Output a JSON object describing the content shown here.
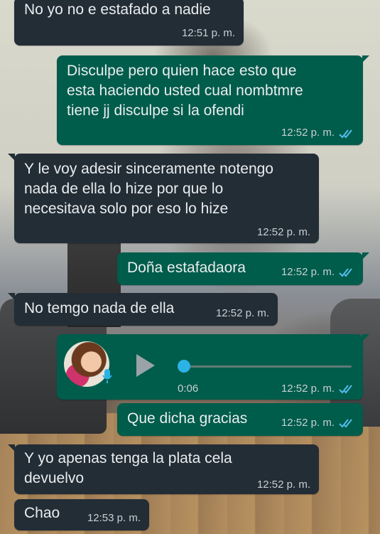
{
  "chat": {
    "messages": [
      {
        "dir": "in",
        "text": "No yo no e estafado a nadie",
        "time": "12:51 p. m."
      },
      {
        "dir": "out",
        "text": "Disculpe pero quien hace esto que\nesta haciendo usted cual nombtmre\ntiene jj disculpe si la ofendi",
        "time": "12:52 p. m.",
        "status": "read"
      },
      {
        "dir": "in",
        "text": "Y le voy adesir sinceramente notengo\nnada de ella lo hize por que lo\nnecesitava solo por eso lo hize",
        "time": "12:52 p. m."
      },
      {
        "dir": "out",
        "text": "Doña estafadaora",
        "time": "12:52 p. m.",
        "status": "read"
      },
      {
        "dir": "in",
        "text": "No temgo nada de ella",
        "time": "12:52 p. m."
      },
      {
        "dir": "out",
        "type": "voice",
        "duration": "0:06",
        "time": "12:52 p. m.",
        "status": "read",
        "progress": 0
      },
      {
        "dir": "out",
        "text": "Que dicha gracias",
        "time": "12:52 p. m.",
        "status": "read"
      },
      {
        "dir": "in",
        "text": "Y yo apenas tenga la plata cela\ndevuelvo",
        "time": "12:52 p. m."
      },
      {
        "dir": "in",
        "text": "Chao",
        "time": "12:53 p. m."
      }
    ]
  },
  "colors": {
    "incoming_bubble": "#232d36",
    "outgoing_bubble": "#005c4b",
    "read_tick": "#53bdeb",
    "voice_knob": "#2bb3e5"
  },
  "icons": {
    "read_status": "double-check-icon",
    "voice_play": "play-icon",
    "voice_mic": "microphone-icon"
  }
}
